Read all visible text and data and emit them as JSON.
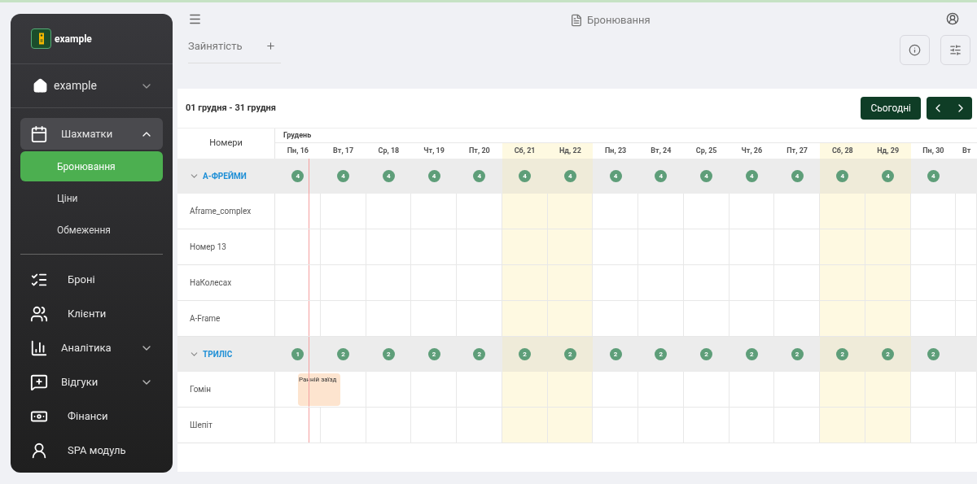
{
  "sidebar": {
    "logo": "example",
    "account": {
      "label": "example",
      "expanded": false
    },
    "items": [
      {
        "kind": "group",
        "label": "Шахматки",
        "expanded": true,
        "children": [
          {
            "label": "Бронювання",
            "selected": true
          },
          {
            "label": "Ціни",
            "selected": false
          },
          {
            "label": "Обмеження",
            "selected": false
          }
        ]
      },
      {
        "kind": "link",
        "label": "Броні"
      },
      {
        "kind": "link",
        "label": "Клієнти"
      },
      {
        "kind": "group",
        "label": "Аналітика",
        "expanded": false
      },
      {
        "kind": "group",
        "label": "Відгуки",
        "expanded": false
      },
      {
        "kind": "link",
        "label": "Фінанси"
      },
      {
        "kind": "link",
        "label": "SPA модуль"
      }
    ]
  },
  "header": {
    "title": "Бронювання"
  },
  "tabs": [
    {
      "label": "Зайнятість",
      "selected": false
    }
  ],
  "calendar": {
    "range": "01 грудня - 31 грудня",
    "today_button": "Сьогодні",
    "rooms_header": "Номери",
    "month": "Грудень",
    "days": [
      {
        "label": "Пн, 16",
        "weekend": false,
        "today": true
      },
      {
        "label": "Вт, 17",
        "weekend": false,
        "today": false
      },
      {
        "label": "Ср, 18",
        "weekend": false,
        "today": false
      },
      {
        "label": "Чт, 19",
        "weekend": false,
        "today": false
      },
      {
        "label": "Пт, 20",
        "weekend": false,
        "today": false
      },
      {
        "label": "Сб, 21",
        "weekend": true,
        "today": false
      },
      {
        "label": "Нд, 22",
        "weekend": true,
        "today": false
      },
      {
        "label": "Пн, 23",
        "weekend": false,
        "today": false
      },
      {
        "label": "Вт, 24",
        "weekend": false,
        "today": false
      },
      {
        "label": "Ср, 25",
        "weekend": false,
        "today": false
      },
      {
        "label": "Чт, 26",
        "weekend": false,
        "today": false
      },
      {
        "label": "Пт, 27",
        "weekend": false,
        "today": false
      },
      {
        "label": "Сб, 28",
        "weekend": true,
        "today": false
      },
      {
        "label": "Нд, 29",
        "weekend": true,
        "today": false
      },
      {
        "label": "Пн, 30",
        "weekend": false,
        "today": false
      },
      {
        "label": "Вт",
        "weekend": false,
        "today": false
      }
    ],
    "groups": [
      {
        "name": "А-ФРЕЙМИ",
        "expanded": true,
        "counts": [
          "4",
          "4",
          "4",
          "4",
          "4",
          "4",
          "4",
          "4",
          "4",
          "4",
          "4",
          "4",
          "4",
          "4",
          "4"
        ],
        "rooms": [
          {
            "name": "Aframe_complex"
          },
          {
            "name": "Номер 13"
          },
          {
            "name": "НаКолесах"
          },
          {
            "name": "A-Frame"
          }
        ]
      },
      {
        "name": "ТРИЛІС",
        "expanded": true,
        "counts": [
          "1",
          "2",
          "2",
          "2",
          "2",
          "2",
          "2",
          "2",
          "2",
          "2",
          "2",
          "2",
          "2",
          "2",
          "2"
        ],
        "rooms": [
          {
            "name": "Гомін",
            "booking": {
              "label": "Ранній заїзд"
            }
          },
          {
            "name": "Шепіт"
          }
        ]
      }
    ]
  }
}
